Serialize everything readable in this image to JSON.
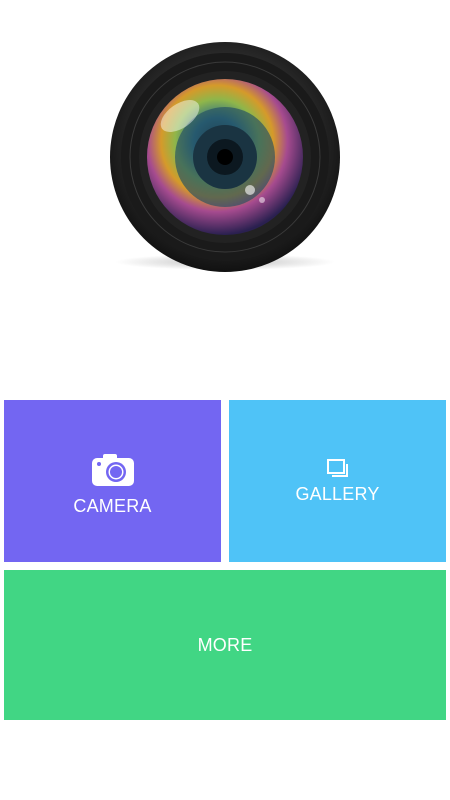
{
  "colors": {
    "camera_tile": "#7366f2",
    "gallery_tile": "#4fc3f7",
    "more_tile": "#41d684",
    "label_text": "#ffffff"
  },
  "hero": {
    "icon": "camera-lens-image"
  },
  "tiles": {
    "camera": {
      "label": "CAMERA",
      "icon": "camera-icon"
    },
    "gallery": {
      "label": "GALLERY",
      "icon": "gallery-icon"
    },
    "more": {
      "label": "MORE"
    }
  }
}
